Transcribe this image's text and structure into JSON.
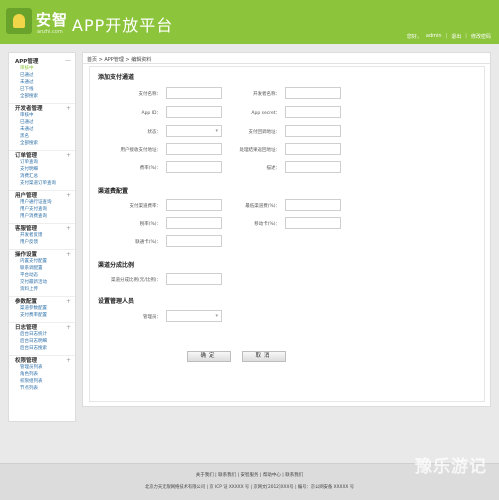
{
  "header": {
    "brand": "安智",
    "brand_sub": "anzhi.com",
    "title": "APP开放平台",
    "links": [
      "您好，",
      "admin",
      "退出",
      "修改密码"
    ]
  },
  "sidebar": {
    "groups": [
      {
        "title": "APP管理",
        "toggle": "—",
        "items": [
          "审核中",
          "已通过",
          "未通过",
          "已下线",
          "全部搜索"
        ]
      },
      {
        "title": "开发者管理",
        "toggle": "+",
        "items": [
          "审核中",
          "已通过",
          "未通过",
          "黑名",
          "全部搜索"
        ]
      },
      {
        "title": "订单管理",
        "toggle": "+",
        "items": [
          "订单查询",
          "支付明细",
          "消费汇总",
          "支付渠道订单查询"
        ]
      },
      {
        "title": "用户管理",
        "toggle": "+",
        "items": [
          "用户通行证查询",
          "用户支付查询",
          "用户消费查询"
        ]
      },
      {
        "title": "客服管理",
        "toggle": "+",
        "items": [
          "开发者反馈",
          "用户反馈"
        ]
      },
      {
        "title": "操作设置",
        "toggle": "+",
        "items": [
          "内置支付配置",
          "联系调配置",
          "平台动态",
          "交付最新活动",
          "资料上传"
        ]
      },
      {
        "title": "参数配置",
        "toggle": "+",
        "items": [
          "渠道参数配置",
          "支付费率配置"
        ]
      },
      {
        "title": "日志管理",
        "toggle": "+",
        "items": [
          "后台日志统计",
          "后台日志明细",
          "后台日志搜索"
        ]
      },
      {
        "title": "权限管理",
        "toggle": "+",
        "items": [
          "管理员列表",
          "角色列表",
          "权限组列表",
          "节点列表"
        ]
      }
    ]
  },
  "breadcrumb": "首页 > APP管理 > 编辑资料",
  "sections": {
    "s1": "添加支付通道",
    "s2": "渠道费配置",
    "s3": "渠道分成比例",
    "s4": "设置管理人员"
  },
  "form": {
    "pay_name": "支付名称：",
    "dev_name": "开发者名称：",
    "app_id": "App ID：",
    "app_secret": "App secret：",
    "status": "状态：",
    "notify_url": "支付回调地址：",
    "callback_url": "用户接收支付地址：",
    "result_url": "处理结果返回地址：",
    "rate": "费率(%)：",
    "desc": "描述：",
    "channel_fee": "支付渠道费率：",
    "fee_cap": "最低渠道费(%)：",
    "tax_rate": "税率(%)：",
    "other_rate": "移动卡(%)：",
    "extra_rate": "联通卡(%)：",
    "split": "渠道分成比例(元/比例)：",
    "manager": "管理员："
  },
  "buttons": {
    "confirm": "确定",
    "cancel": "取消"
  },
  "footer": {
    "links": "关于我们 | 联系我们 | 安智服务 | 帮助中心 | 联系我们",
    "copyright": "北京力天无限网络技术有限公司   |   京 ICP 证   XXXXX 号   |   京网文[2012]XXX号   |   编号：京公网安备 XXXXX 号"
  },
  "watermark": "豫乐游记"
}
